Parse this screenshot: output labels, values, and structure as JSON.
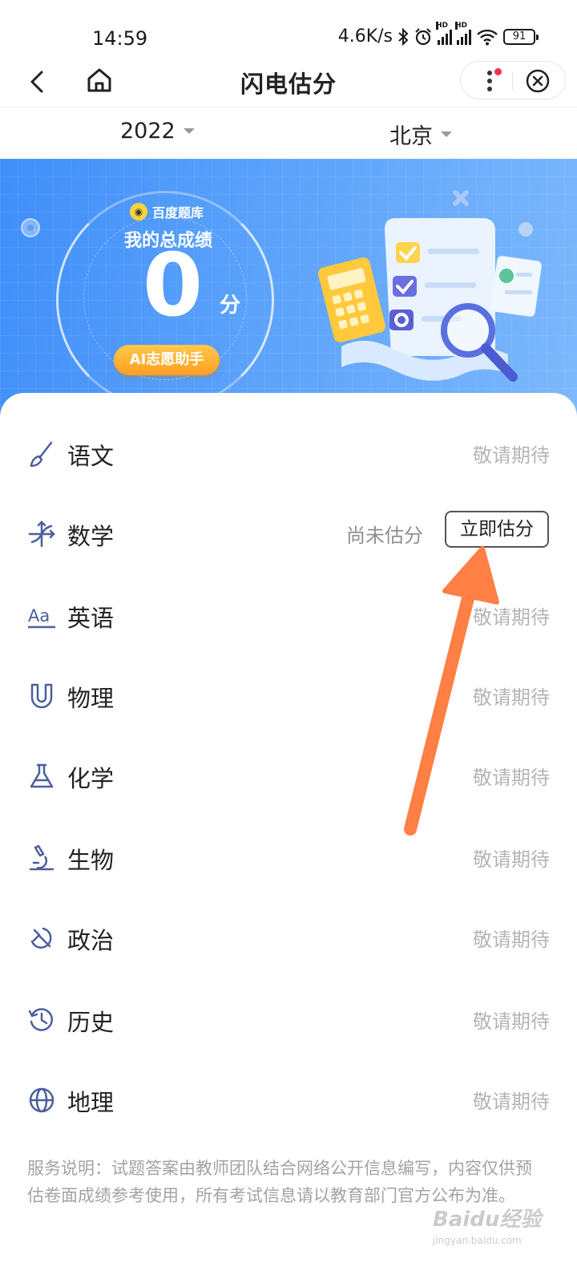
{
  "status_bar": {
    "time": "14:59",
    "net_speed": "4.6K/s",
    "hd": "HD",
    "battery": "91"
  },
  "nav": {
    "title": "闪电估分"
  },
  "filters": {
    "year": "2022",
    "region": "北京"
  },
  "banner": {
    "brand": "百度题库",
    "score_label": "我的总成绩",
    "score": "0",
    "score_unit": "分",
    "ai_button": "AI志愿助手"
  },
  "subjects": [
    {
      "name": "语文",
      "icon": "brush-icon",
      "status": "敬请期待"
    },
    {
      "name": "数学",
      "icon": "axes-icon",
      "status": "尚未估分",
      "action": "立即估分"
    },
    {
      "name": "英语",
      "icon": "aa-icon",
      "status": "敬请期待"
    },
    {
      "name": "物理",
      "icon": "magnet-icon",
      "status": "敬请期待"
    },
    {
      "name": "化学",
      "icon": "flask-icon",
      "status": "敬请期待"
    },
    {
      "name": "生物",
      "icon": "microscope-icon",
      "status": "敬请期待"
    },
    {
      "name": "政治",
      "icon": "hammer-sickle-icon",
      "status": "敬请期待"
    },
    {
      "name": "历史",
      "icon": "history-icon",
      "status": "敬请期待"
    },
    {
      "name": "地理",
      "icon": "globe-icon",
      "status": "敬请期待"
    }
  ],
  "notice": "服务说明：试题答案由教师团队结合网络公开信息编写，内容仅供预估卷面成绩参考使用，所有考试信息请以教育部门官方公布为准。",
  "watermark": {
    "main": "Baidu经验",
    "sub": "jingyan.baidu.com"
  },
  "colors": {
    "banner": "#4d98fa",
    "accent_orange": "#ff7f45",
    "icon_blue": "#4a5f9e",
    "ai_button": "#ffb23a"
  }
}
